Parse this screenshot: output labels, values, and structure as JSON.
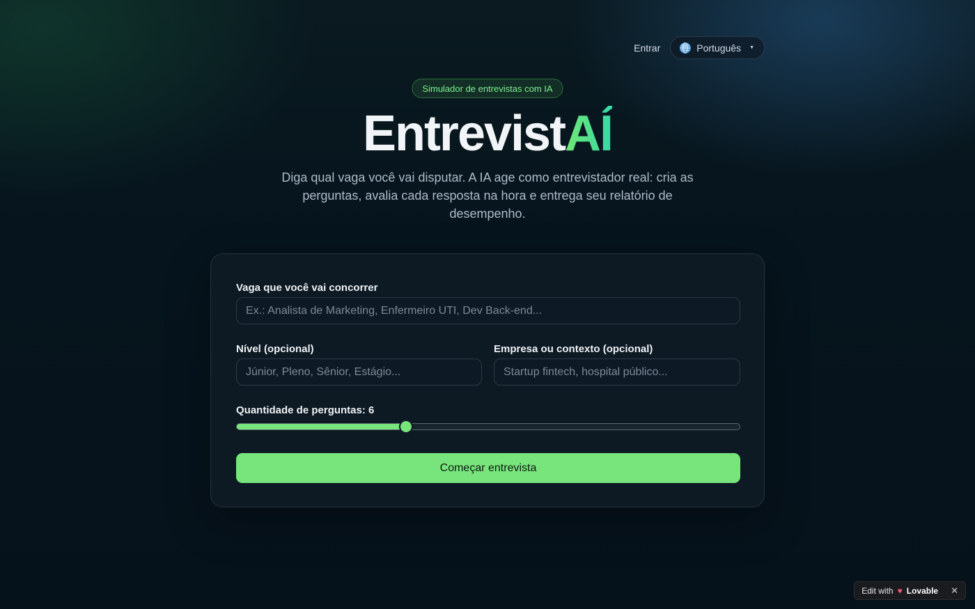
{
  "nav": {
    "login_label": "Entrar",
    "language": "Português",
    "language_icon": "globe-icon"
  },
  "hero": {
    "badge": "Simulador de entrevistas com IA",
    "brand_part1": "Entrevist",
    "brand_part2": "AÍ",
    "subtitle": "Diga qual vaga você vai disputar. A IA age como entrevistador real: cria as perguntas, avalia cada resposta na hora e entrega seu relatório de desempenho."
  },
  "form": {
    "role_label": "Vaga que você vai concorrer",
    "role_placeholder": "Ex.: Analista de Marketing, Enfermeiro UTI, Dev Back-end...",
    "role_value": "",
    "level_label": "Nível (opcional)",
    "level_placeholder": "Júnior, Pleno, Sênior, Estágio...",
    "level_value": "",
    "company_label": "Empresa ou contexto (opcional)",
    "company_placeholder": "Startup fintech, hospital público...",
    "company_value": "",
    "questions_label": "Quantidade de perguntas: 6",
    "questions_count": 6,
    "questions_slider_fraction": 0.336,
    "start_button": "Começar entrevista"
  },
  "footer_badge": {
    "edit_with": "Edit with",
    "brand": "Lovable"
  },
  "colors": {
    "accent_green": "#78e57c",
    "brand_gradient_end": "#38d8a8",
    "background": "#06141d"
  }
}
